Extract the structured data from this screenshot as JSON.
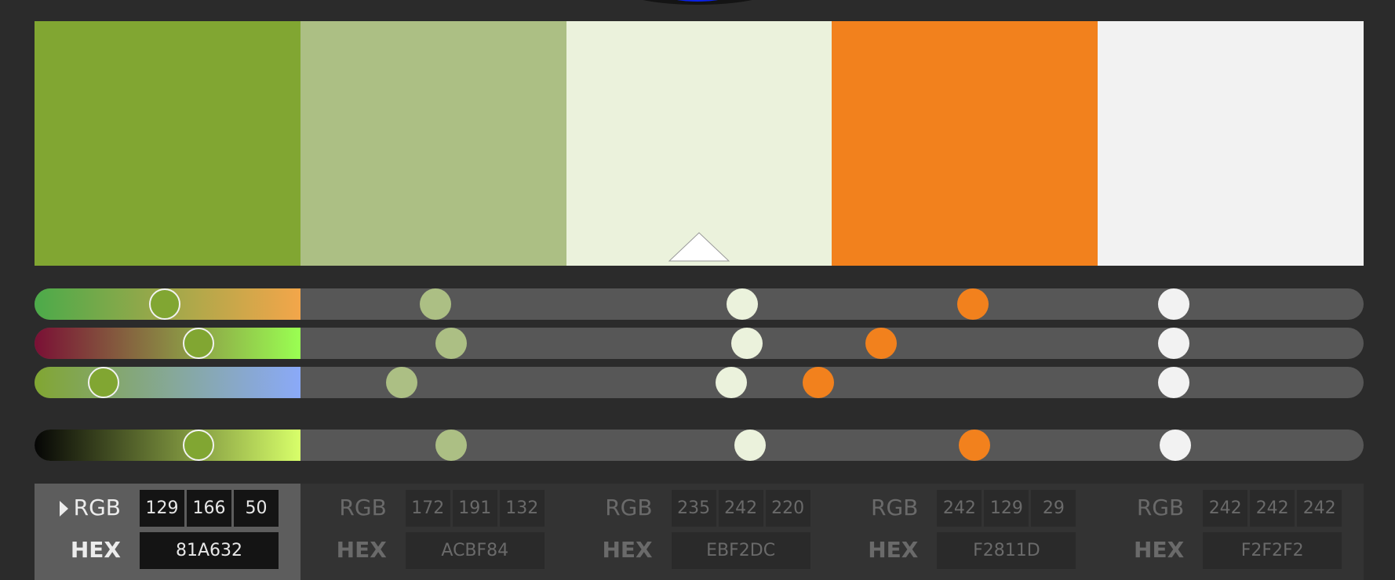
{
  "swatches": [
    {
      "name": "swatch-1",
      "color": "#81A632",
      "rgb": [
        "129",
        "166",
        "50"
      ],
      "hex": "81A632",
      "active": true
    },
    {
      "name": "swatch-2",
      "color": "#ACBF84",
      "rgb": [
        "172",
        "191",
        "132"
      ],
      "hex": "ACBF84",
      "active": false
    },
    {
      "name": "swatch-3",
      "color": "#EBF2DC",
      "rgb": [
        "235",
        "242",
        "220"
      ],
      "hex": "EBF2DC",
      "active": false
    },
    {
      "name": "swatch-4",
      "color": "#F2811D",
      "rgb": [
        "242",
        "129",
        "29"
      ],
      "hex": "F2811D",
      "active": false
    },
    {
      "name": "swatch-5",
      "color": "#F2F2F2",
      "rgb": [
        "242",
        "242",
        "242"
      ],
      "hex": "F2F2F2",
      "active": false
    }
  ],
  "labels": {
    "rgb": "RGB",
    "hex": "HEX"
  },
  "sliders": [
    {
      "name": "slider-row-1",
      "gradient": "linear-gradient(90deg,#4caa4a,#f3a64a)",
      "fractions": [
        0.088,
        0.297,
        0.533,
        0.711,
        0.866
      ]
    },
    {
      "name": "slider-row-2",
      "gradient": "linear-gradient(90deg,#7a1035,#9aff52)",
      "fractions": [
        0.114,
        0.309,
        0.537,
        0.64,
        0.866
      ]
    },
    {
      "name": "slider-row-3",
      "gradient": "linear-gradient(90deg,#81a632,#8aa9f8)",
      "fractions": [
        0.041,
        0.271,
        0.525,
        0.592,
        0.866
      ]
    },
    {
      "name": "slider-row-4",
      "gradient": "linear-gradient(90deg,#050505,#d8ff6a)",
      "fractions": [
        0.114,
        0.309,
        0.539,
        0.712,
        0.867
      ]
    }
  ],
  "accent": {
    "wheel": "#0a22e6",
    "pointer": "#ffffff"
  }
}
